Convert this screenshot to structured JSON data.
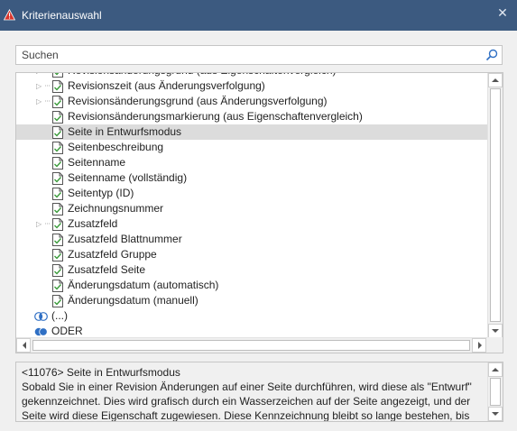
{
  "window": {
    "title": "Kriterienauswahl",
    "close_glyph": "✕"
  },
  "search": {
    "placeholder": "Suchen",
    "value": ""
  },
  "tree": {
    "rows": [
      {
        "label": "Revisionsänderungsgrund (aus Eigenschaftenvergleich)",
        "expander": true,
        "level": 2,
        "selected": false,
        "partial": true
      },
      {
        "label": "Revisionszeit (aus Änderungsverfolgung)",
        "expander": true,
        "level": 2,
        "selected": false
      },
      {
        "label": "Revisionsänderungsgrund (aus Änderungsverfolgung)",
        "expander": true,
        "level": 2,
        "selected": false
      },
      {
        "label": "Revisionsänderungsmarkierung (aus Eigenschaftenvergleich)",
        "expander": false,
        "level": 2,
        "selected": false
      },
      {
        "label": "Seite in Entwurfsmodus",
        "expander": false,
        "level": 2,
        "selected": true
      },
      {
        "label": "Seitenbeschreibung",
        "expander": false,
        "level": 2,
        "selected": false
      },
      {
        "label": "Seitenname",
        "expander": false,
        "level": 2,
        "selected": false
      },
      {
        "label": "Seitenname (vollständig)",
        "expander": false,
        "level": 2,
        "selected": false
      },
      {
        "label": "Seitentyp (ID)",
        "expander": false,
        "level": 2,
        "selected": false
      },
      {
        "label": "Zeichnungsnummer",
        "expander": false,
        "level": 2,
        "selected": false
      },
      {
        "label": "Zusatzfeld",
        "expander": true,
        "level": 2,
        "selected": false
      },
      {
        "label": "Zusatzfeld Blattnummer",
        "expander": false,
        "level": 2,
        "selected": false
      },
      {
        "label": "Zusatzfeld Gruppe",
        "expander": false,
        "level": 2,
        "selected": false
      },
      {
        "label": "Zusatzfeld Seite",
        "expander": false,
        "level": 2,
        "selected": false
      },
      {
        "label": "Änderungsdatum (automatisch)",
        "expander": false,
        "level": 2,
        "selected": false
      },
      {
        "label": "Änderungsdatum (manuell)",
        "expander": false,
        "level": 2,
        "selected": false
      },
      {
        "label": "(...)",
        "expander": false,
        "level": 1,
        "selected": false,
        "icon": "venn-and-icon"
      },
      {
        "label": "ODER",
        "expander": false,
        "level": 1,
        "selected": false,
        "icon": "venn-or-icon"
      }
    ]
  },
  "description": {
    "heading": "<11076> Seite in Entwurfsmodus",
    "body": "Sobald Sie in einer Revision Änderungen auf einer Seite durchführen, wird diese als \"Entwurf\" gekennzeichnet. Dies wird grafisch durch ein Wasserzeichen auf der Seite angezeigt, und der Seite wird diese Eigenschaft zugewiesen. Diese Kennzeichnung bleibt so lange bestehen, bis Sie die"
  },
  "colors": {
    "titlebar": "#3c5a80",
    "selection": "#dcdcdc",
    "check": "#3a9b3a",
    "venn_blue": "#2f6fc4"
  }
}
